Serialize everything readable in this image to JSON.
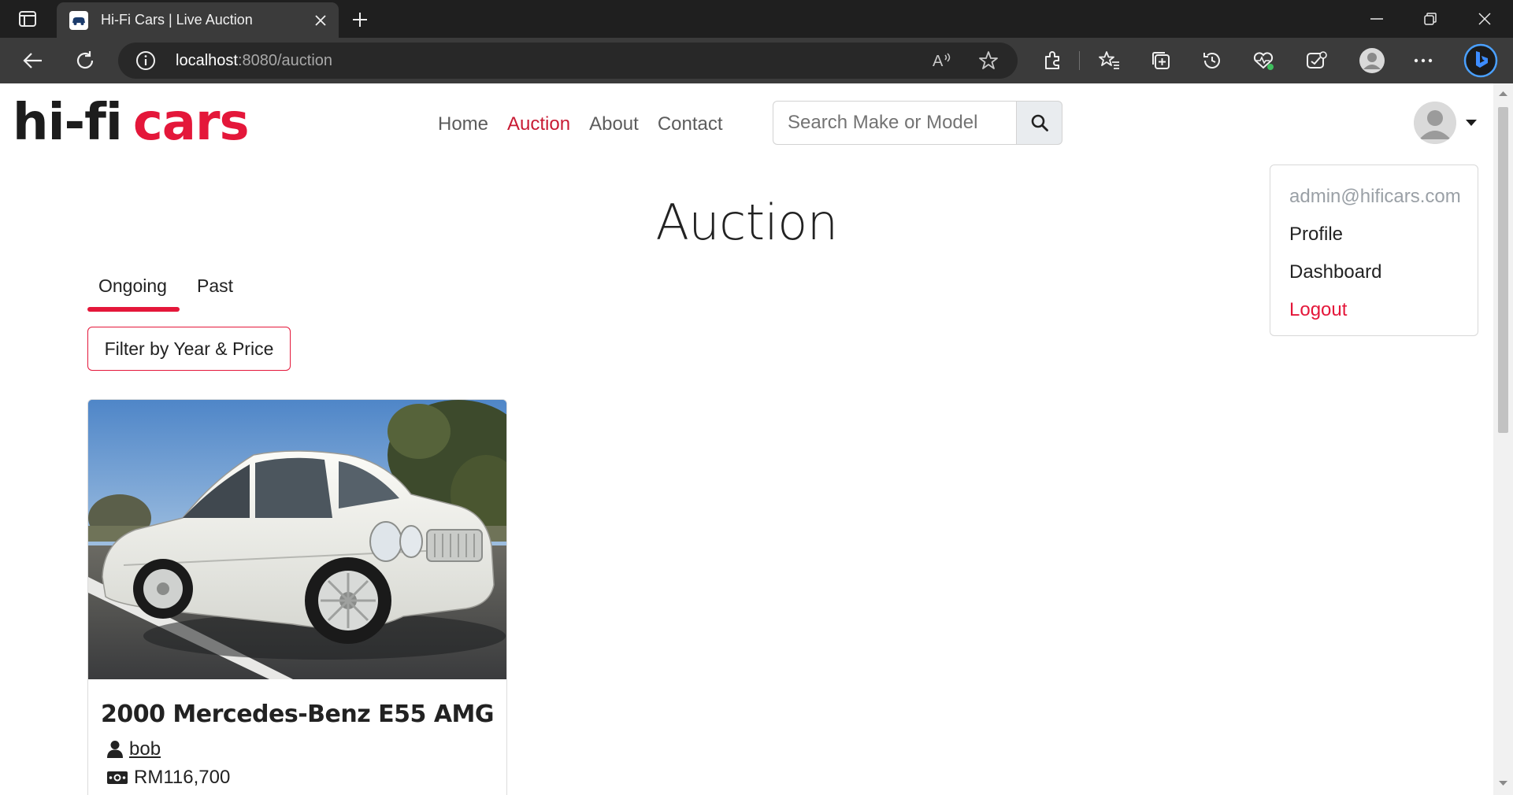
{
  "browser": {
    "tab_title": "Hi-Fi Cars | Live Auction",
    "url_host": "localhost",
    "url_rest": ":8080/auction"
  },
  "site": {
    "logo_part1": "hi-fi",
    "logo_part2": "cars",
    "brand_color": "#e4173a",
    "nav": [
      {
        "label": "Home",
        "active": false
      },
      {
        "label": "Auction",
        "active": true
      },
      {
        "label": "About",
        "active": false
      },
      {
        "label": "Contact",
        "active": false
      }
    ],
    "search_placeholder": "Search Make or Model"
  },
  "user_menu": {
    "email": "admin@hificars.com",
    "items": [
      "Profile",
      "Dashboard",
      "Logout"
    ]
  },
  "main": {
    "title": "Auction",
    "tabs": [
      {
        "label": "Ongoing",
        "active": true
      },
      {
        "label": "Past",
        "active": false
      }
    ],
    "filter_label": "Filter by Year & Price",
    "listings": [
      {
        "title": "2000 Mercedes-Benz E55 AMG",
        "seller": "bob",
        "price": "RM116,700"
      }
    ]
  }
}
